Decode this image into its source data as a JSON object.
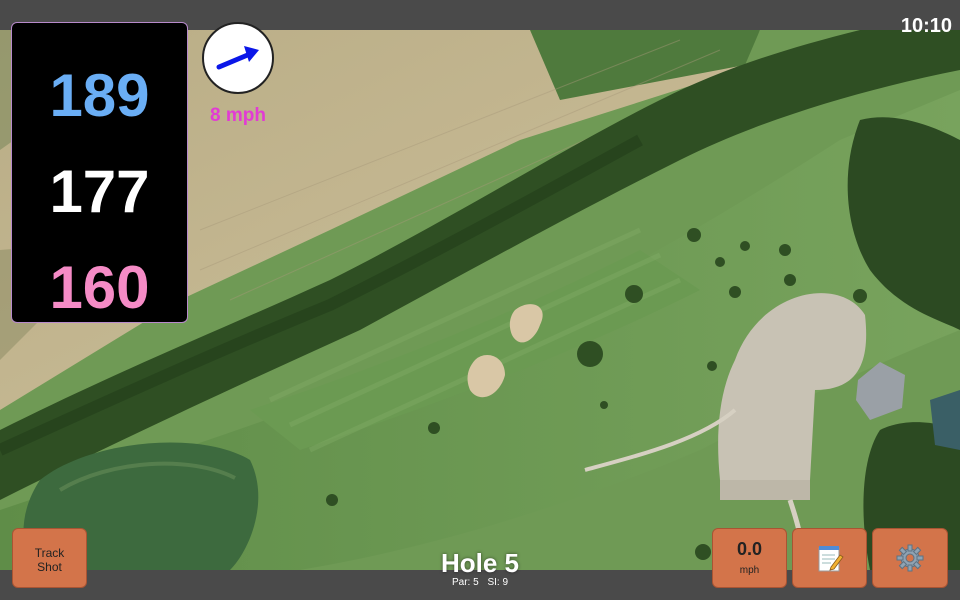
{
  "status_bar": {
    "time": "10:10"
  },
  "distances": {
    "back": "189",
    "middle": "177",
    "front": "160"
  },
  "wind": {
    "speed_label": "8 mph",
    "icon": "wind-direction-arrow-icon"
  },
  "hole": {
    "title": "Hole 5",
    "par_label": "Par: 5",
    "si_label": "SI: 9"
  },
  "buttons": {
    "track_shot_line1": "Track",
    "track_shot_line2": "Shot",
    "speed_value": "0.0",
    "speed_unit": "mph",
    "notes_icon": "notepad-icon",
    "settings_icon": "gear-icon"
  },
  "colors": {
    "back_distance": "#6aaef5",
    "middle_distance": "#ffffff",
    "front_distance": "#f58bc6",
    "wind_speed": "#e23bd4",
    "button_accent": "#d3744a",
    "bar_background": "#4a4a4a"
  }
}
